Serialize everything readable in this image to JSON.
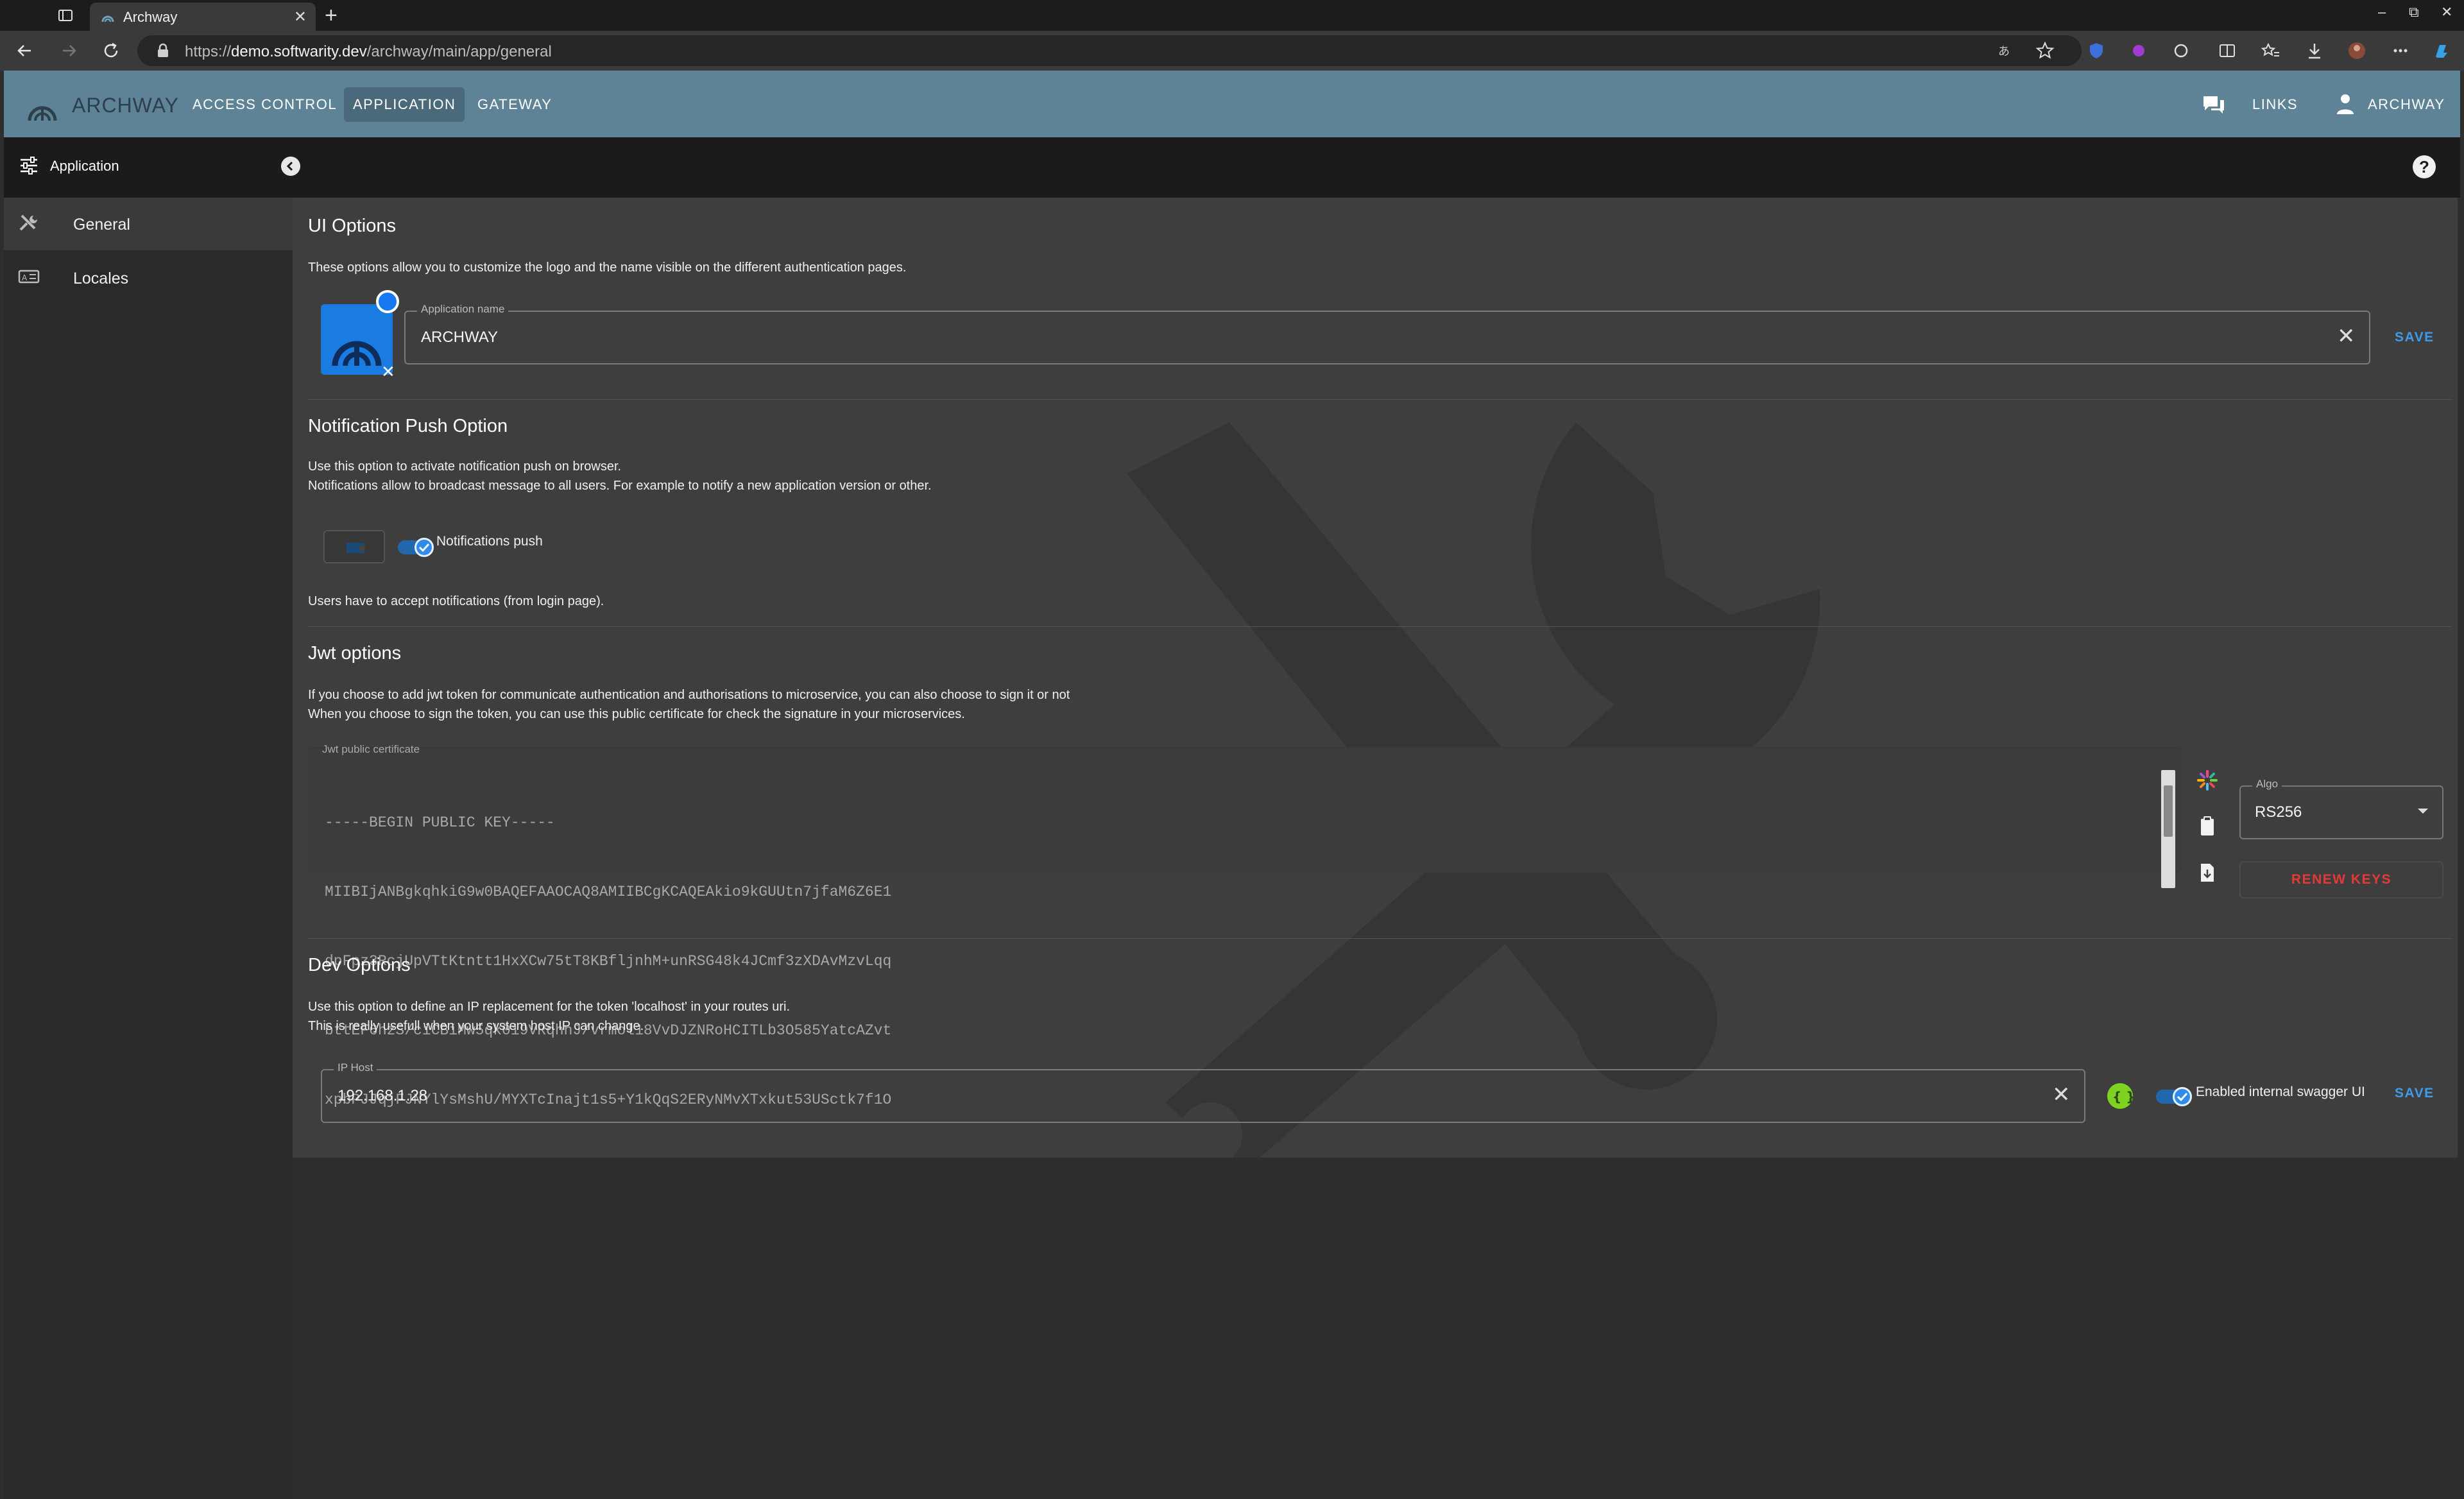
{
  "browser": {
    "tab_title": "Archway",
    "url_scheme": "https://",
    "url_host": "demo.softwarity.dev",
    "url_path": "/archway/main/app/general"
  },
  "header": {
    "brand": "ARCHWAY",
    "nav": [
      "ACCESS CONTROL",
      "APPLICATION",
      "GATEWAY"
    ],
    "active_nav": "APPLICATION",
    "links": "LINKS",
    "user": "ARCHWAY",
    "bg_color": "#5f8396"
  },
  "subbar": {
    "title": "Application",
    "help": "?"
  },
  "sidebar": {
    "items": [
      {
        "label": "General",
        "icon": "tools-icon",
        "active": true
      },
      {
        "label": "Locales",
        "icon": "locale-icon",
        "active": false
      }
    ]
  },
  "ui_options": {
    "title": "UI Options",
    "description": "These options allow you to customize the logo and the name visible on the different authentication pages.",
    "app_name_label": "Application name",
    "app_name_value": "ARCHWAY",
    "save": "SAVE"
  },
  "notification": {
    "title": "Notification Push Option",
    "desc_line1": "Use this option to activate notification push on browser.",
    "desc_line2": "Notifications allow to broadcast message to all users. For example to notify a new application version or other.",
    "toggle_label": "Notifications push",
    "enabled": true,
    "note": "Users have to accept notifications (from login page)."
  },
  "jwt": {
    "title": "Jwt options",
    "desc_line1": "If you choose to add jwt token for communicate authentication and authorisations to microservice, you can also choose to sign it or not",
    "desc_line2": "When you choose to sign the token, you can use this public certificate for check the signature in your microservices.",
    "cert_label": "Jwt public certificate",
    "cert_lines": [
      "-----BEGIN PUBLIC KEY-----",
      "MIIBIjANBgkqhkiG9w0BAQEFAAOCAQ8AMIIBCgKCAQEAkio9kGUUtn7jfaM6Z6E1",
      "dpFpz3RcjUpVTtKtntt1HxXCw75tT8KBfljnhM+unRSG48k4JCmf3zXDAvMzvLqq",
      "bttEF6hzS/ciCBiMw5qk0i9VRqhnJ/vrmol18VvDJZNRoHCITLb3O585YatcAZvt",
      "xpbPJJqjFJNYlYsMshU/MYXTcInajt1s5+Y1kQqS2ERyNMvXTxkut53USctk7f1O"
    ],
    "algo_label": "Algo",
    "algo_value": "RS256",
    "renew": "RENEW KEYS"
  },
  "dev": {
    "title": "Dev Options",
    "desc_line1": "Use this option to define an IP replacement for the token 'localhost' in your routes uri.",
    "desc_line2": "This is really usefull when your system host IP can change.",
    "ip_label": "IP Host",
    "ip_value": "192.168.1.28",
    "swagger_label": "Enabled internal swagger UI",
    "swagger_enabled": true,
    "save": "SAVE"
  },
  "colors": {
    "accent": "#3f9be8",
    "danger": "#e53935",
    "toggle": "#2f8ceb"
  }
}
